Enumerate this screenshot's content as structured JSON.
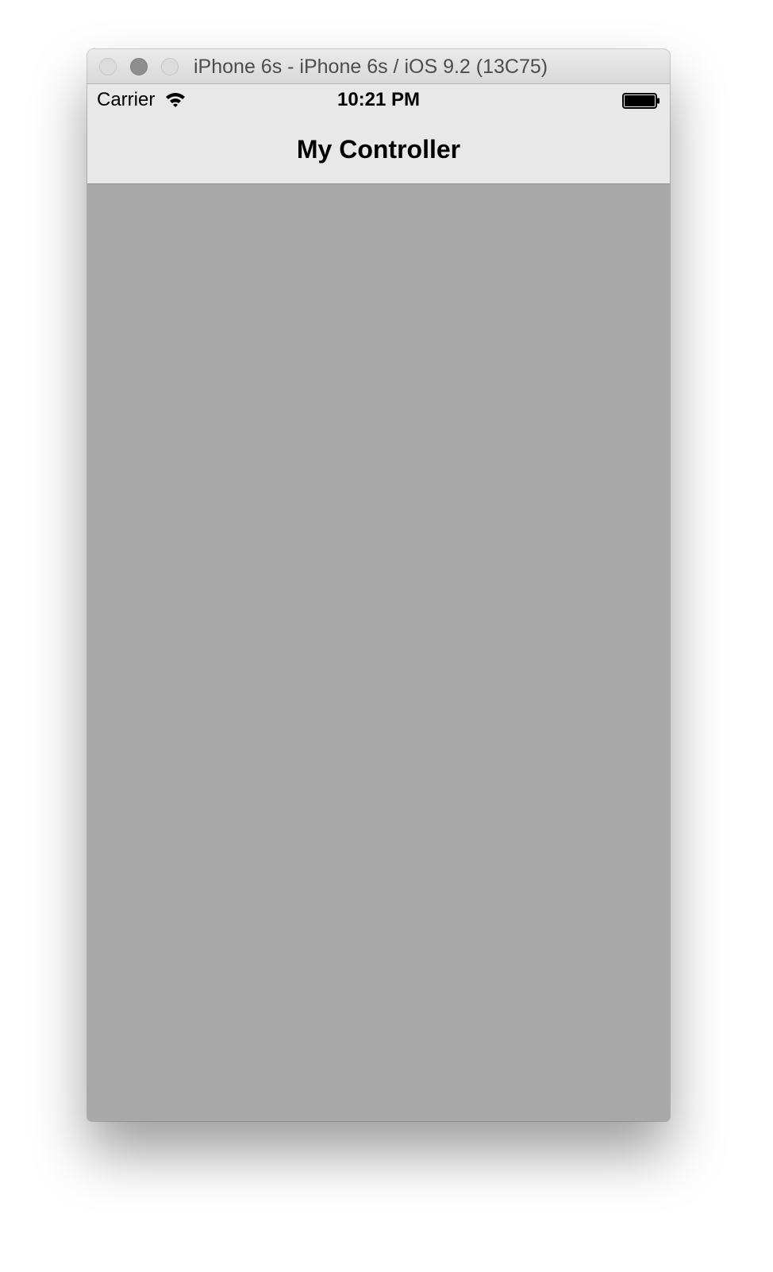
{
  "window": {
    "title": "iPhone 6s - iPhone 6s / iOS 9.2 (13C75)"
  },
  "status_bar": {
    "carrier": "Carrier",
    "wifi_icon": "wifi-icon",
    "time": "10:21 PM",
    "battery_icon": "battery-icon",
    "battery_level": 1.0
  },
  "navigation_bar": {
    "title": "My Controller"
  },
  "colors": {
    "content_background": "#a9a9a9",
    "navbar_background": "#e8e8e8"
  }
}
